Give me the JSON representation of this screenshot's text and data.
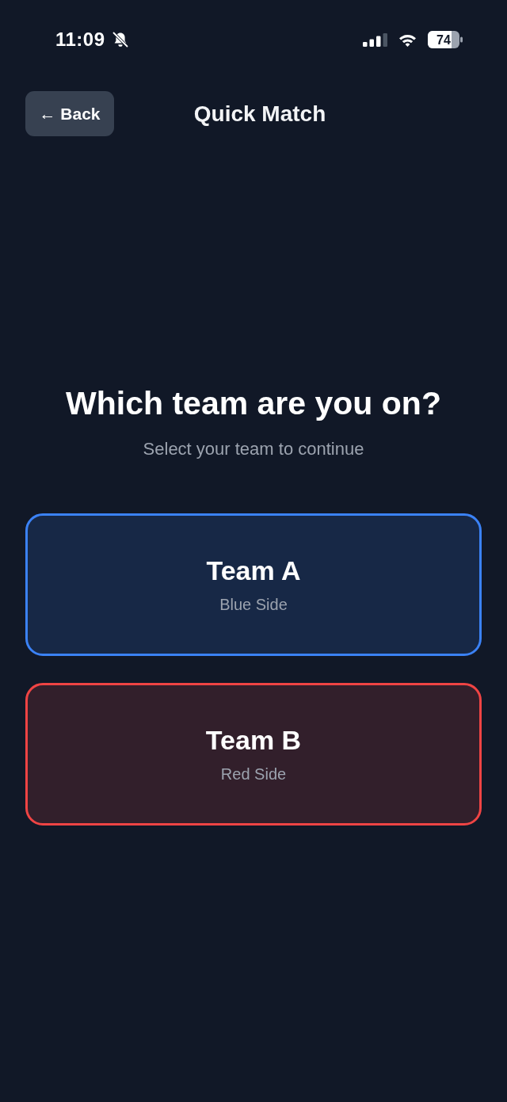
{
  "status_bar": {
    "time": "11:09",
    "battery": "74"
  },
  "header": {
    "back_label": "← Back",
    "title": "Quick Match"
  },
  "prompt": {
    "heading": "Which team are you on?",
    "subheading": "Select your team to continue"
  },
  "teams": [
    {
      "name": "Team A",
      "side": "Blue Side",
      "color": "#3b82f6",
      "selected": false
    },
    {
      "name": "Team B",
      "side": "Red Side",
      "color": "#ef4444",
      "selected": false
    }
  ]
}
